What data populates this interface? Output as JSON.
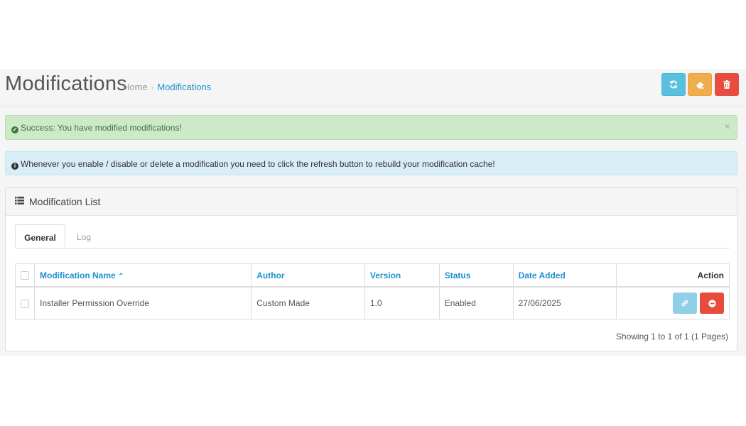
{
  "header": {
    "title": "Modifications",
    "breadcrumb": {
      "home": "Home",
      "current": "Modifications"
    },
    "buttons": {
      "refresh": "refresh-icon",
      "clear": "eraser-icon",
      "delete": "trash-icon"
    }
  },
  "alerts": {
    "success": "Success: You have modified modifications!",
    "info": "Whenever you enable / disable or delete a modification you need to click the refresh button to rebuild your modification cache!"
  },
  "panel": {
    "title": "Modification List",
    "tabs": [
      {
        "label": "General"
      },
      {
        "label": "Log"
      }
    ]
  },
  "table": {
    "columns": {
      "name": "Modification Name",
      "author": "Author",
      "version": "Version",
      "status": "Status",
      "date_added": "Date Added",
      "action": "Action"
    },
    "rows": [
      {
        "name": "Installer Permission Override",
        "author": "Custom Made",
        "version": "1.0",
        "status": "Enabled",
        "date_added": "27/06/2025"
      }
    ]
  },
  "pagination": {
    "text": "Showing 1 to 1 of 1 (1 Pages)"
  },
  "colors": {
    "primary": "#1e91cf",
    "info": "#5bc0de",
    "warning": "#f0ad4e",
    "danger": "#e74c3c",
    "success_bg": "#cde9c8",
    "info_bg": "#d9edf7"
  }
}
